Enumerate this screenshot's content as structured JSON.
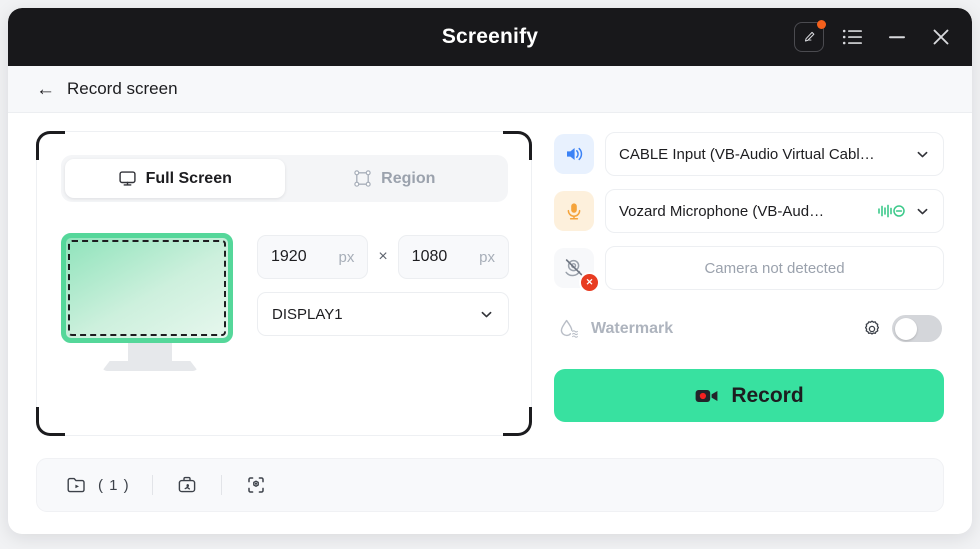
{
  "window": {
    "title": "Screenify",
    "actions": [
      {
        "name": "edit-button",
        "icon": "pencil-edit-icon",
        "badge": true
      },
      {
        "name": "menu-button",
        "icon": "list-menu-icon"
      },
      {
        "name": "minimize-button",
        "icon": "minimize-icon"
      },
      {
        "name": "close-button",
        "icon": "close-icon"
      }
    ]
  },
  "subheader": {
    "back_icon": "arrow-left-icon",
    "title": "Record screen"
  },
  "capture": {
    "tabs": [
      {
        "label": "Full Screen",
        "icon": "monitor-icon",
        "active": true
      },
      {
        "label": "Region",
        "icon": "crop-region-icon",
        "active": false
      }
    ],
    "width_value": "1920",
    "width_unit": "px",
    "separator": "×",
    "height_value": "1080",
    "height_unit": "px",
    "display_select": "DISPLAY1",
    "chevron_icon": "chevron-down-icon"
  },
  "devices": {
    "speaker": {
      "icon": "speaker-icon",
      "label": "CABLE Input (VB-Audio Virtual Cabl…",
      "chevron_icon": "chevron-down-icon"
    },
    "microphone": {
      "icon": "microphone-icon",
      "label": "Vozard Microphone (VB-Aud…",
      "level_icon": "audio-level-icon",
      "chevron_icon": "chevron-down-icon"
    },
    "camera": {
      "icon": "camera-off-icon",
      "badge_icon": "error-x-icon",
      "label": "Camera not detected"
    }
  },
  "watermark": {
    "icon": "watermark-droplet-icon",
    "label": "Watermark",
    "settings_icon": "gear-icon",
    "enabled": false
  },
  "record": {
    "label": "Record",
    "icon": "video-camera-icon"
  },
  "bottom_bar": {
    "folder_icon": "folder-open-icon",
    "folder_count": "( 1 )",
    "tools_icon": "toolbox-icon",
    "scan_icon": "scan-target-icon"
  },
  "colors": {
    "titlebar": "#18181b",
    "accent_green": "#38e1a0",
    "badge_orange": "#f4601c",
    "error_red": "#e83c21",
    "speaker_blue": "#3b82f6",
    "mic_orange": "#f5a43c"
  }
}
